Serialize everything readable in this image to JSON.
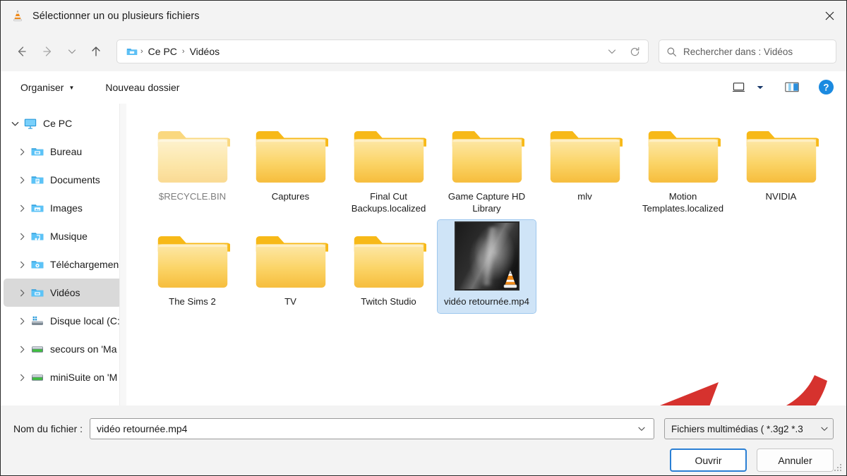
{
  "window": {
    "title": "Sélectionner un ou plusieurs fichiers",
    "app_icon": "vlc-cone-icon",
    "close_label": "✕"
  },
  "nav": {
    "back_icon": "arrow-left-icon",
    "forward_icon": "arrow-right-icon",
    "recent_icon": "chevron-down-icon",
    "up_icon": "arrow-up-icon",
    "address": {
      "icon": "folder-videos-icon",
      "crumbs": [
        "Ce PC",
        "Vidéos"
      ],
      "separator": "›",
      "history_icon": "chevron-down-icon",
      "refresh_icon": "refresh-icon"
    },
    "search": {
      "icon": "search-icon",
      "placeholder": "Rechercher dans : Vidéos"
    }
  },
  "toolbar": {
    "organize_label": "Organiser",
    "organize_caret": "▼",
    "new_folder_label": "Nouveau dossier",
    "view_icon": "view-layout-icon",
    "view_caret_icon": "chevron-down-icon",
    "preview_pane_icon": "preview-pane-icon",
    "help_icon": "help-icon",
    "help_glyph": "?"
  },
  "sidebar": {
    "items": [
      {
        "label": "Ce PC",
        "icon": "monitor-icon",
        "expanded": true,
        "indent": false,
        "selected": false
      },
      {
        "label": "Bureau",
        "icon": "folder-desktop-icon",
        "expanded": false,
        "indent": true,
        "selected": false
      },
      {
        "label": "Documents",
        "icon": "folder-documents-icon",
        "expanded": false,
        "indent": true,
        "selected": false
      },
      {
        "label": "Images",
        "icon": "folder-pictures-icon",
        "expanded": false,
        "indent": true,
        "selected": false
      },
      {
        "label": "Musique",
        "icon": "folder-music-icon",
        "expanded": false,
        "indent": true,
        "selected": false
      },
      {
        "label": "Téléchargemen",
        "icon": "folder-downloads-icon",
        "expanded": false,
        "indent": true,
        "selected": false
      },
      {
        "label": "Vidéos",
        "icon": "folder-videos-icon",
        "expanded": false,
        "indent": true,
        "selected": true
      },
      {
        "label": "Disque local (C:",
        "icon": "local-disk-icon",
        "expanded": false,
        "indent": true,
        "selected": false
      },
      {
        "label": "secours on 'Ma",
        "icon": "network-drive-icon",
        "expanded": false,
        "indent": true,
        "selected": false
      },
      {
        "label": "miniSuite on 'M",
        "icon": "network-drive-icon",
        "expanded": false,
        "indent": true,
        "selected": false
      }
    ]
  },
  "files": {
    "items": [
      {
        "name": "$RECYCLE.BIN",
        "type": "folder",
        "dim": true,
        "selected": false
      },
      {
        "name": "Captures",
        "type": "folder",
        "dim": false,
        "selected": false
      },
      {
        "name": "Final Cut Backups.localized",
        "type": "folder",
        "dim": false,
        "selected": false
      },
      {
        "name": "Game Capture HD Library",
        "type": "folder",
        "dim": false,
        "selected": false
      },
      {
        "name": "mlv",
        "type": "folder",
        "dim": false,
        "selected": false
      },
      {
        "name": "Motion Templates.localized",
        "type": "folder",
        "dim": false,
        "selected": false
      },
      {
        "name": "NVIDIA",
        "type": "folder",
        "dim": false,
        "selected": false
      },
      {
        "name": "The Sims 2",
        "type": "folder",
        "dim": false,
        "selected": false
      },
      {
        "name": "TV",
        "type": "folder",
        "dim": false,
        "selected": false
      },
      {
        "name": "Twitch Studio",
        "type": "folder",
        "dim": false,
        "selected": false
      },
      {
        "name": "vidéo retournée.mp4",
        "type": "video",
        "dim": false,
        "selected": true
      }
    ]
  },
  "annotation": {
    "shape": "curved-arrow-left",
    "color": "#d6322e",
    "points_to": "vidéo retournée.mp4"
  },
  "footer": {
    "filename_label": "Nom du fichier :",
    "filename_value": "vidéo retournée.mp4",
    "filename_caret_icon": "chevron-down-icon",
    "filter_value": "Fichiers multimédias ( *.3g2 *.3",
    "filter_caret_icon": "chevron-down-icon",
    "open_label": "Ouvrir",
    "cancel_label": "Annuler",
    "resize_grip": "resize-grip-icon"
  },
  "colors": {
    "accent": "#2a7fd4",
    "selection": "#cfe4f7",
    "folder": "#f9c846",
    "annotation": "#d6322e"
  }
}
